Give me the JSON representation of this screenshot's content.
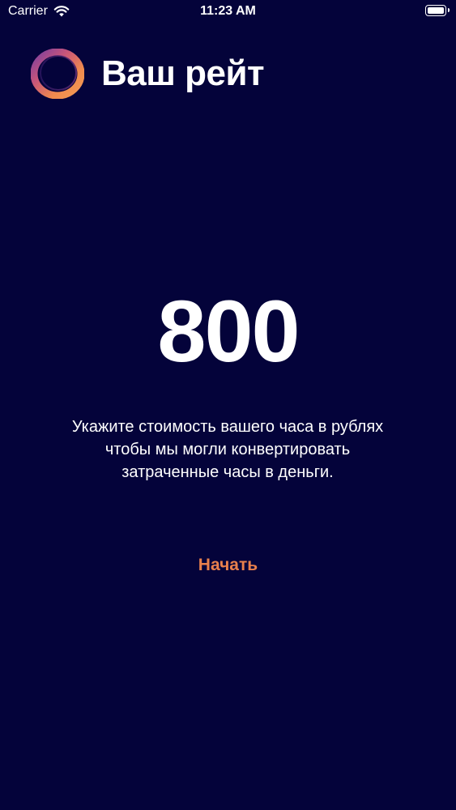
{
  "status_bar": {
    "carrier": "Carrier",
    "time": "11:23 AM"
  },
  "header": {
    "title": "Ваш рейт",
    "logo_icon": "ring-logo-icon"
  },
  "rate": {
    "value": "800"
  },
  "description": {
    "text": "Укажите стоимость вашего часа в рублях чтобы мы могли конвертировать затраченные часы в деньги."
  },
  "actions": {
    "start_label": "Начать"
  },
  "colors": {
    "background": "#04033a",
    "accent": "#e9804c",
    "text": "#ffffff"
  }
}
